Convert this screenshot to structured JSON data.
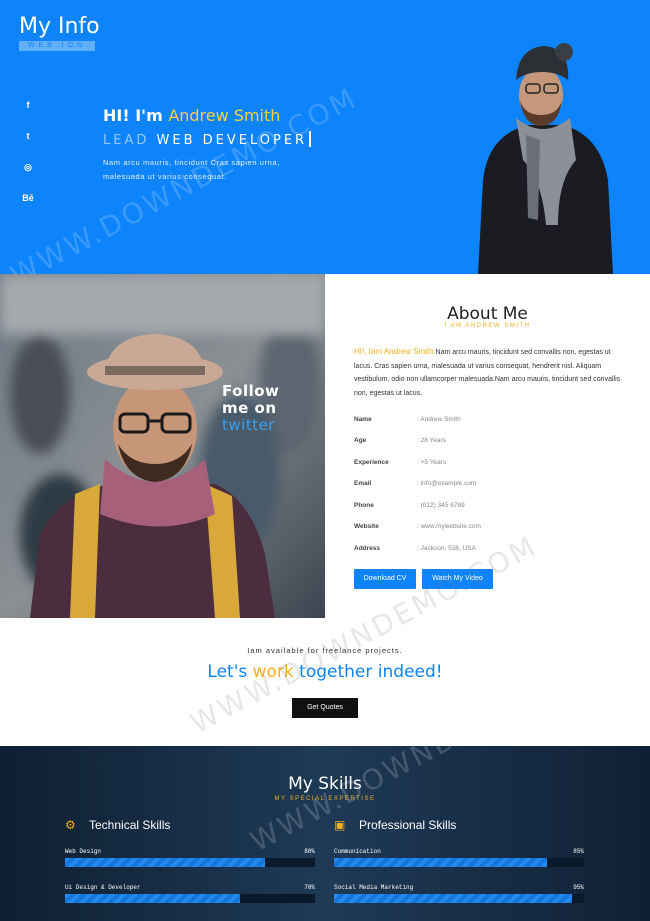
{
  "hero": {
    "logo_title": "My Info",
    "logo_sub": "WEB ION",
    "social_icons": [
      "facebook-icon",
      "twitter-icon",
      "instagram-icon",
      "behance-icon"
    ],
    "social_glyphs": [
      "f",
      "t",
      "◎",
      "Bē"
    ],
    "greeting_prefix": "HI! I'm",
    "name": "Andrew Smith",
    "role_dim": "LEAD",
    "role": "WEB DEVELOPER",
    "description": "Nam arcu mauris, tincidunt Cras sapien urna, malesuada ut varius consequat."
  },
  "about": {
    "title": "About Me",
    "subtitle": "I AM ANDREW SMITH",
    "highlight": "HI!, Iam Andrew Smith",
    "text": " Nam arcu mauris, tincidunt sed convallis non, egestas ut lacus. Cras sapien urna, malesuada ut varius consequat, hendrerit nisl. Aliquam vestibulum, odio non ullamcorper malesuada.Nam arcu mauris, tincidunt sed convallis non, egestas ut lacus.",
    "follow_line1": "Follow",
    "follow_line2": "me on",
    "follow_line3": "twitter",
    "info": [
      {
        "label": "Name",
        "value": ": Andrew Smith"
      },
      {
        "label": "Age",
        "value": ": 28 Years"
      },
      {
        "label": "Experience",
        "value": ": +5 Years"
      },
      {
        "label": "Email",
        "value": ": info@example.com"
      },
      {
        "label": "Phone",
        "value": ": (012) 345 6789"
      },
      {
        "label": "Website",
        "value": ": www.mywebsite.com"
      },
      {
        "label": "Address",
        "value": ": Jackson, 538, USA"
      }
    ],
    "download_cv": "Download CV",
    "watch_video": "Watch My Video"
  },
  "cta": {
    "small": "Iam available for freelance projects.",
    "big_1": "Let's",
    "big_2": "work",
    "big_3": "together indeed!",
    "button": "Get Quotes"
  },
  "skills": {
    "title": "My Skills",
    "subtitle": "MY SPECIAL EXPERTISE",
    "technical_title": "Technical Skills",
    "professional_title": "Professional Skills",
    "technical": [
      {
        "label": "Web Design",
        "pct_text": "80%",
        "pct": 0.8
      },
      {
        "label": "Ui Design & Developer",
        "pct_text": "70%",
        "pct": 0.7
      }
    ],
    "professional": [
      {
        "label": "Communication",
        "pct_text": "85%",
        "pct": 0.85
      },
      {
        "label": "Social Media Marketing",
        "pct_text": "95%",
        "pct": 0.95
      }
    ]
  },
  "watermark": "WWW.DOWNDEMO.COM",
  "colors": {
    "accent": "#0e84fc",
    "highlight": "#f2b01e",
    "name_yellow": "#f7d23c"
  }
}
